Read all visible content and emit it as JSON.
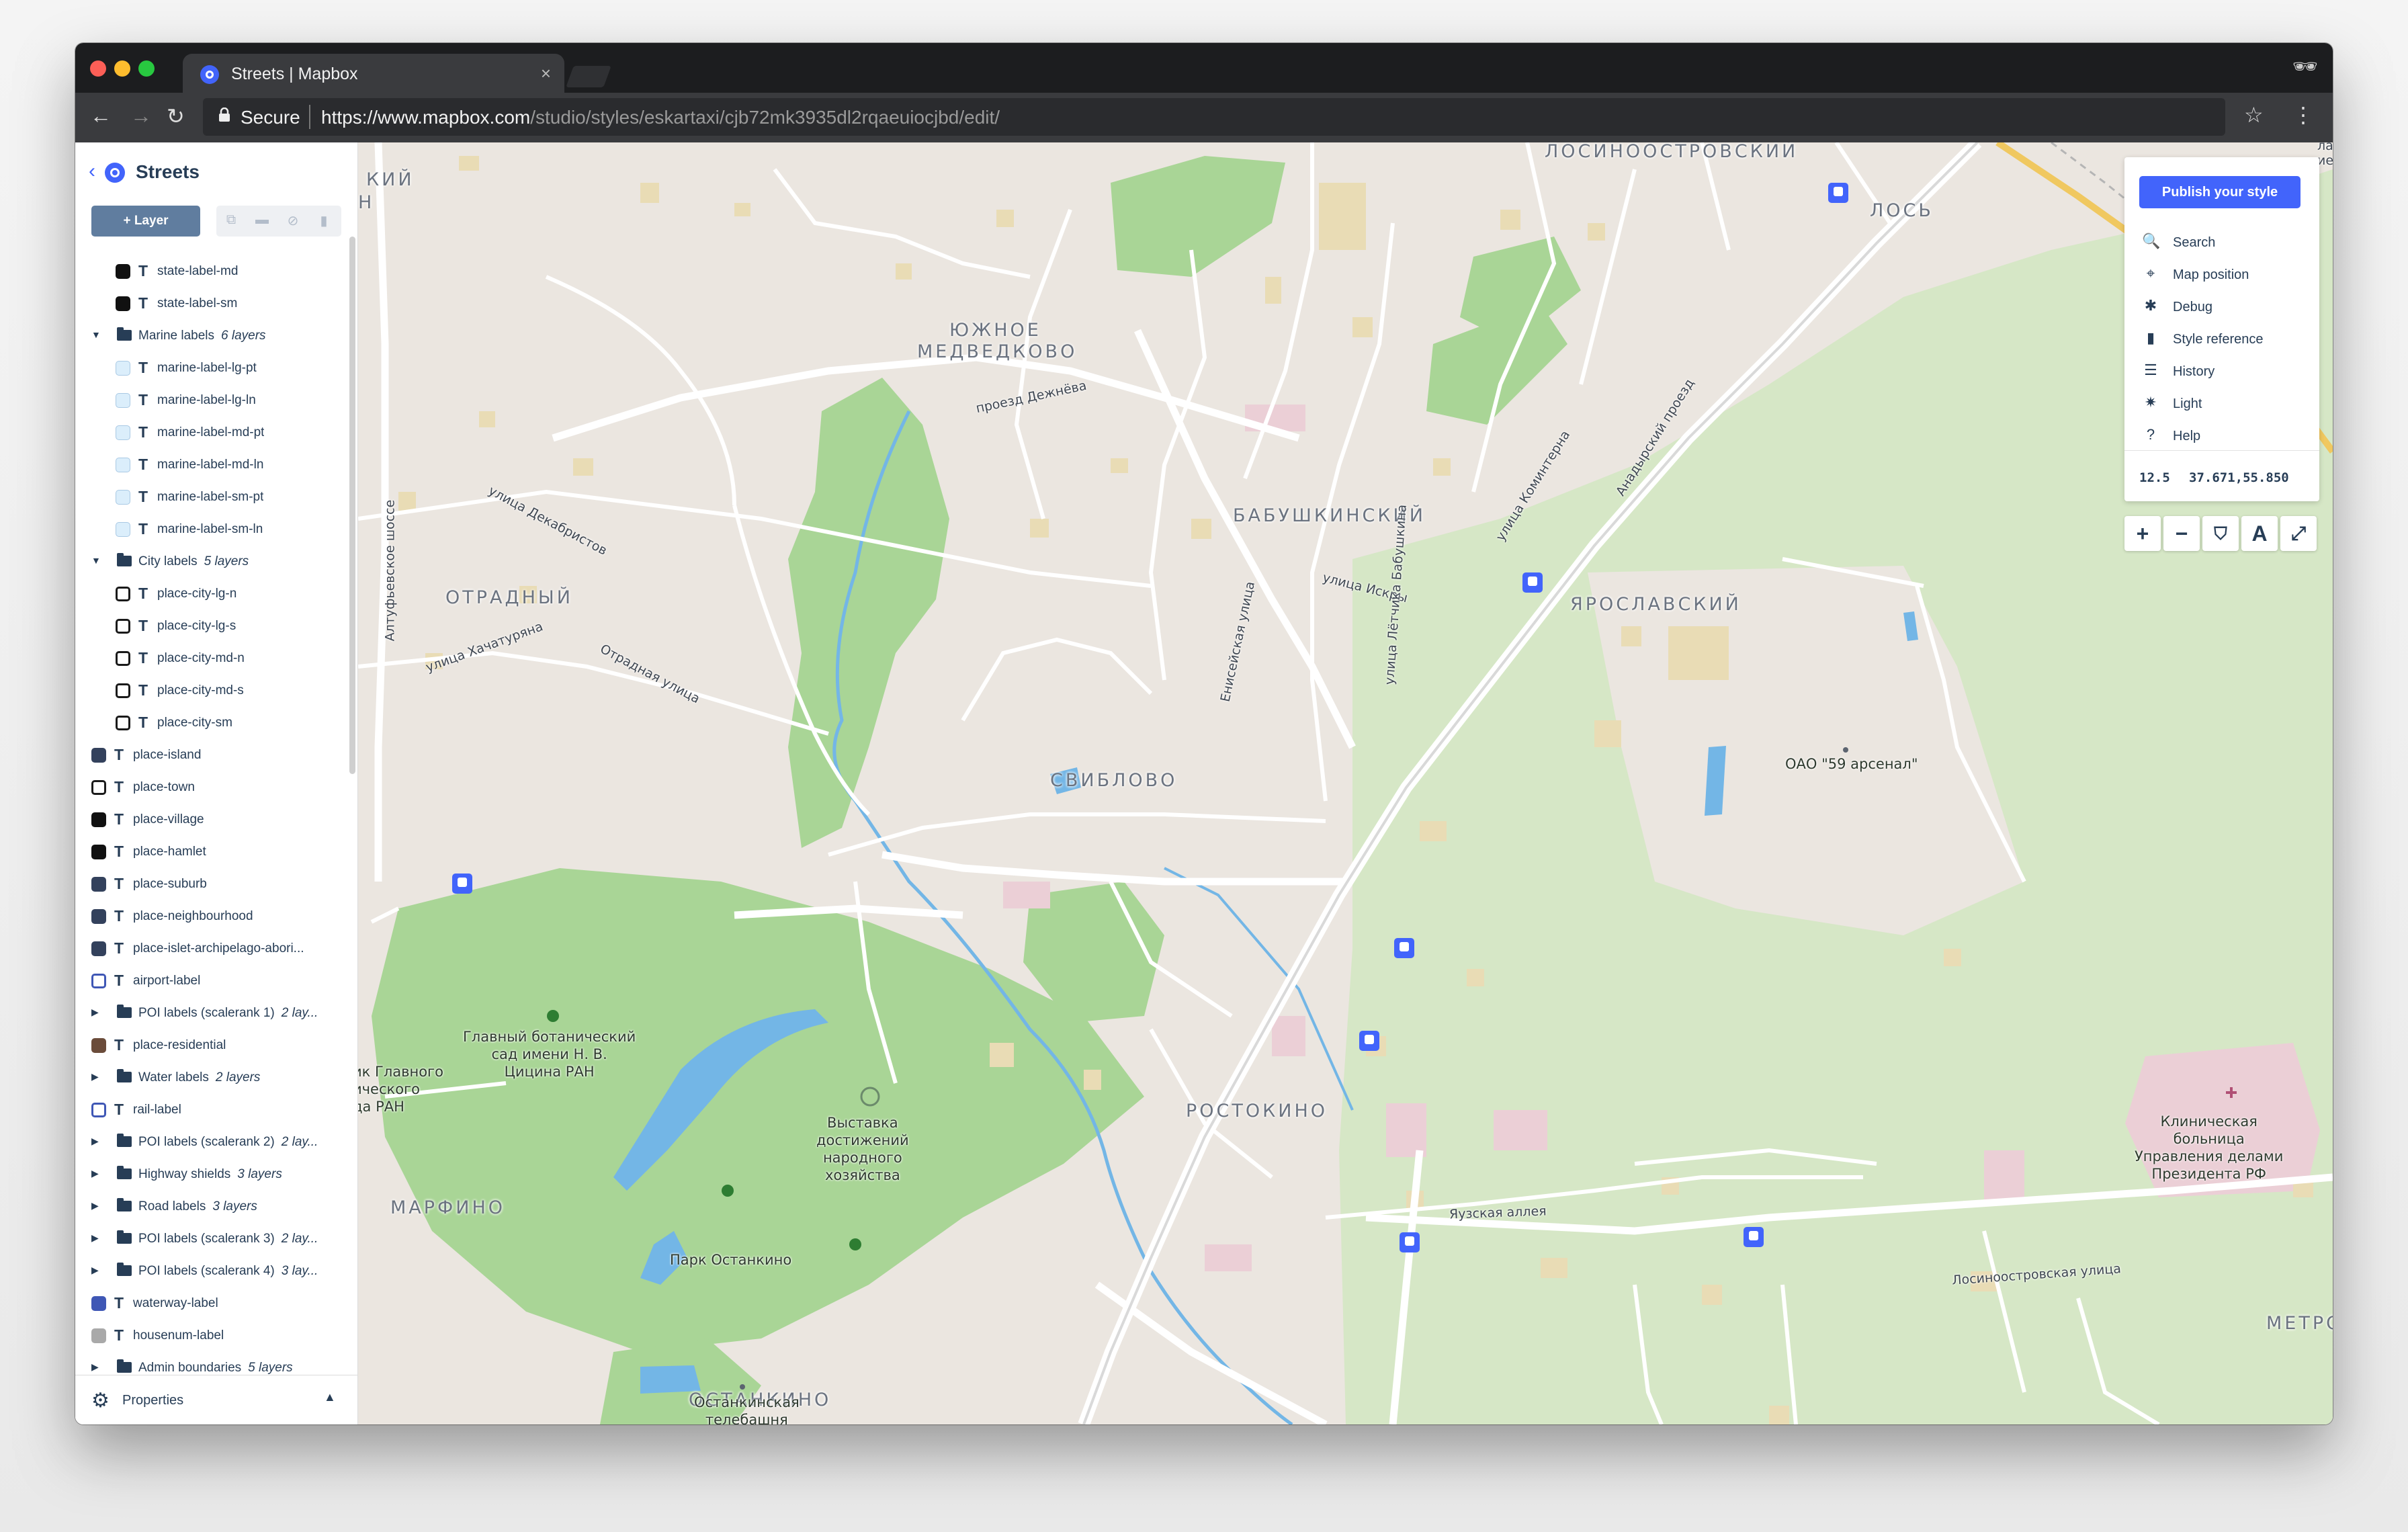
{
  "browser": {
    "tab_title": "Streets | Mapbox",
    "tab_close": "×",
    "secure_label": "Secure",
    "url_scheme": "https://",
    "url_host": "www.mapbox.com",
    "url_path": "/studio/styles/eskartaxi/cjb72mk3935dl2rqaeuiocjbd/edit/",
    "back": "←",
    "forward": "→",
    "reload": "↻",
    "star": "☆",
    "menu": "⋮",
    "incognito": "🕶"
  },
  "sidebar": {
    "back": "‹",
    "title": "Streets",
    "add_layer": "+ Layer",
    "properties": "Properties",
    "properties_caret": "▲",
    "layers": [
      {
        "label": "state-label-md",
        "indent": 2,
        "kind": "symbol",
        "swatch": "#111111"
      },
      {
        "label": "state-label-sm",
        "indent": 2,
        "kind": "symbol",
        "swatch": "#111111"
      },
      {
        "label": "Marine labels",
        "sub": "6 layers",
        "indent": 1,
        "kind": "group",
        "open": true
      },
      {
        "label": "marine-label-lg-pt",
        "indent": 2,
        "kind": "symbol",
        "swatch": "#dbeefb"
      },
      {
        "label": "marine-label-lg-ln",
        "indent": 2,
        "kind": "symbol",
        "swatch": "#dbeefb"
      },
      {
        "label": "marine-label-md-pt",
        "indent": 2,
        "kind": "symbol",
        "swatch": "#dbeefb"
      },
      {
        "label": "marine-label-md-ln",
        "indent": 2,
        "kind": "symbol",
        "swatch": "#dbeefb"
      },
      {
        "label": "marine-label-sm-pt",
        "indent": 2,
        "kind": "symbol",
        "swatch": "#dbeefb"
      },
      {
        "label": "marine-label-sm-ln",
        "indent": 2,
        "kind": "symbol",
        "swatch": "#dbeefb"
      },
      {
        "label": "City labels",
        "sub": "5 layers",
        "indent": 1,
        "kind": "group",
        "open": true
      },
      {
        "label": "place-city-lg-n",
        "indent": 2,
        "kind": "symbol",
        "swatch": "icon"
      },
      {
        "label": "place-city-lg-s",
        "indent": 2,
        "kind": "symbol",
        "swatch": "icon"
      },
      {
        "label": "place-city-md-n",
        "indent": 2,
        "kind": "symbol",
        "swatch": "icon"
      },
      {
        "label": "place-city-md-s",
        "indent": 2,
        "kind": "symbol",
        "swatch": "icon"
      },
      {
        "label": "place-city-sm",
        "indent": 2,
        "kind": "symbol",
        "swatch": "icon"
      },
      {
        "label": "place-island",
        "indent": 0,
        "kind": "symbol",
        "swatch": "#33415c"
      },
      {
        "label": "place-town",
        "indent": 0,
        "kind": "symbol",
        "swatch": "icon"
      },
      {
        "label": "place-village",
        "indent": 0,
        "kind": "symbol",
        "swatch": "#111111"
      },
      {
        "label": "place-hamlet",
        "indent": 0,
        "kind": "symbol",
        "swatch": "#111111"
      },
      {
        "label": "place-suburb",
        "indent": 0,
        "kind": "symbol",
        "swatch": "#33415c"
      },
      {
        "label": "place-neighbourhood",
        "indent": 0,
        "kind": "symbol",
        "swatch": "#33415c"
      },
      {
        "label": "place-islet-archipelago-abori...",
        "indent": 0,
        "kind": "symbol",
        "swatch": "#33415c"
      },
      {
        "label": "airport-label",
        "indent": 0,
        "kind": "symbol",
        "swatch": "icon-blue"
      },
      {
        "label": "POI labels (scalerank 1)",
        "sub": "2 lay...",
        "indent": 1,
        "kind": "group",
        "open": false
      },
      {
        "label": "place-residential",
        "indent": 0,
        "kind": "symbol",
        "swatch": "#6b4c3a"
      },
      {
        "label": "Water labels",
        "sub": "2 layers",
        "indent": 1,
        "kind": "group",
        "open": false
      },
      {
        "label": "rail-label",
        "indent": 0,
        "kind": "symbol",
        "swatch": "icon-blue"
      },
      {
        "label": "POI labels (scalerank 2)",
        "sub": "2 lay...",
        "indent": 1,
        "kind": "group",
        "open": false
      },
      {
        "label": "Highway shields",
        "sub": "3 layers",
        "indent": 1,
        "kind": "group",
        "open": false
      },
      {
        "label": "Road labels",
        "sub": "3 layers",
        "indent": 1,
        "kind": "group",
        "open": false
      },
      {
        "label": "POI labels (scalerank 3)",
        "sub": "2 lay...",
        "indent": 1,
        "kind": "group",
        "open": false
      },
      {
        "label": "POI labels (scalerank 4)",
        "sub": "3 lay...",
        "indent": 1,
        "kind": "group",
        "open": false
      },
      {
        "label": "waterway-label",
        "indent": 0,
        "kind": "symbol",
        "swatch": "#3f57b5"
      },
      {
        "label": "housenum-label",
        "indent": 0,
        "kind": "symbol",
        "swatch": "#a9a9a9"
      },
      {
        "label": "Admin boundaries",
        "sub": "5 layers",
        "indent": 1,
        "kind": "group",
        "open": false
      }
    ]
  },
  "panel": {
    "publish": "Publish your style",
    "items": [
      {
        "label": "Search",
        "icon": "search-icon",
        "glyph": "🔍"
      },
      {
        "label": "Map position",
        "icon": "crosshair-icon",
        "glyph": "⌖"
      },
      {
        "label": "Debug",
        "icon": "bug-icon",
        "glyph": "✱"
      },
      {
        "label": "Style reference",
        "icon": "book-icon",
        "glyph": "▮"
      },
      {
        "label": "History",
        "icon": "history-icon",
        "glyph": "☰"
      },
      {
        "label": "Light",
        "icon": "light-icon",
        "glyph": "✷"
      },
      {
        "label": "Help",
        "icon": "help-icon",
        "glyph": "?"
      }
    ],
    "zoom": "12.5",
    "coords": "37.671,55.850",
    "controls": [
      "+",
      "−",
      "⛉",
      "A",
      "⤢"
    ]
  },
  "map": {
    "labels": {
      "losinoostrovsky": "ЛОСИНООСТРОВСКИЙ",
      "los": "ЛОСЬ",
      "yuzhnoe1": "ЮЖНОЕ",
      "yuzhnoe2": "МЕДВЕДКОВО",
      "babushkinsky": "БАБУШКИНСКИЙ",
      "otradny": "ОТРАДНЫЙ",
      "yaroslavsky": "ЯРОСЛАВСКИЙ",
      "sviblovo": "СВИБЛОВО",
      "rostokino": "РОСТОКИНО",
      "marfino": "МАРФИНО",
      "ostankino": "ОСТАНКИНО",
      "metrogorod": "МЕТРОГОРОД",
      "kiy": "КИЙ",
      "n_letter": "Н",
      "la": "ла",
      "ie": "ие",
      "dezhneva": "проезд Дежнёва",
      "dekabristov": "улица Декабристов",
      "khachaturyana": "улица Хачатуряна",
      "otradnaya": "Отрадная улица",
      "enisei": "Енисейская улица",
      "iskry": "улица Искры",
      "babushkina": "улица Лётчика Бабушкина",
      "komintern": "улица Коминтерна",
      "anadyr": "Анадырский проезд",
      "altufevskoe": "Алтуфьевское шоссе",
      "yauzskaya": "Яузская аллея",
      "losinoostr_st": "Лосиноостровская улица",
      "arsenal": "ОАО \"59 арсенал\"",
      "botan": "Главный ботанический\nсад имени Н. В.\nЦицина РАН",
      "botan_left": "ик Главного\nического\nда РАН",
      "vdnh": "Выставка\nдостижений\nнародного\nхозяйства",
      "park_ost": "Парк Останкино",
      "clinic": "Клиническая\nбольница\nУправления делами\nПрезидента РФ",
      "tower": "Останкинская\nтелебашня"
    }
  }
}
